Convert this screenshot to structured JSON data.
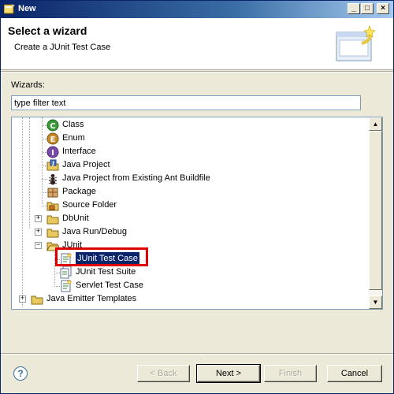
{
  "window": {
    "title": "New",
    "controls": {
      "minimize": "_",
      "maximize": "□",
      "close": "×"
    }
  },
  "banner": {
    "title": "Select a wizard",
    "subtitle": "Create a JUnit Test Case",
    "image": "wizard-banner-icon"
  },
  "wizards_label": "Wizards:",
  "filter": {
    "value": "type filter text",
    "placeholder": "type filter text"
  },
  "tree": {
    "items": [
      {
        "label": "Class",
        "icon": "class-icon"
      },
      {
        "label": "Enum",
        "icon": "enum-icon"
      },
      {
        "label": "Interface",
        "icon": "interface-icon"
      },
      {
        "label": "Java Project",
        "icon": "java-project-icon"
      },
      {
        "label": "Java Project from Existing Ant Buildfile",
        "icon": "ant-icon"
      },
      {
        "label": "Package",
        "icon": "package-icon"
      },
      {
        "label": "Source Folder",
        "icon": "source-folder-icon"
      },
      {
        "label": "DbUnit",
        "icon": "folder-icon",
        "expander": "+"
      },
      {
        "label": "Java Run/Debug",
        "icon": "folder-icon",
        "expander": "+"
      },
      {
        "label": "JUnit",
        "icon": "folder-open-icon",
        "expander": "−"
      },
      {
        "label": "JUnit Test Case",
        "icon": "junit-test-case-icon",
        "selected": true
      },
      {
        "label": "JUnit Test Suite",
        "icon": "junit-test-suite-icon"
      },
      {
        "label": "Servlet Test Case",
        "icon": "servlet-test-case-icon"
      },
      {
        "label": "Java Emitter Templates",
        "icon": "folder-icon",
        "expander": "+"
      }
    ]
  },
  "buttons": {
    "help": "?",
    "back": "< Back",
    "next": "Next >",
    "finish": "Finish",
    "cancel": "Cancel"
  },
  "colors": {
    "selection": "#0a246a",
    "highlight_box": "#e00000",
    "titlebar": "#0a246a"
  }
}
